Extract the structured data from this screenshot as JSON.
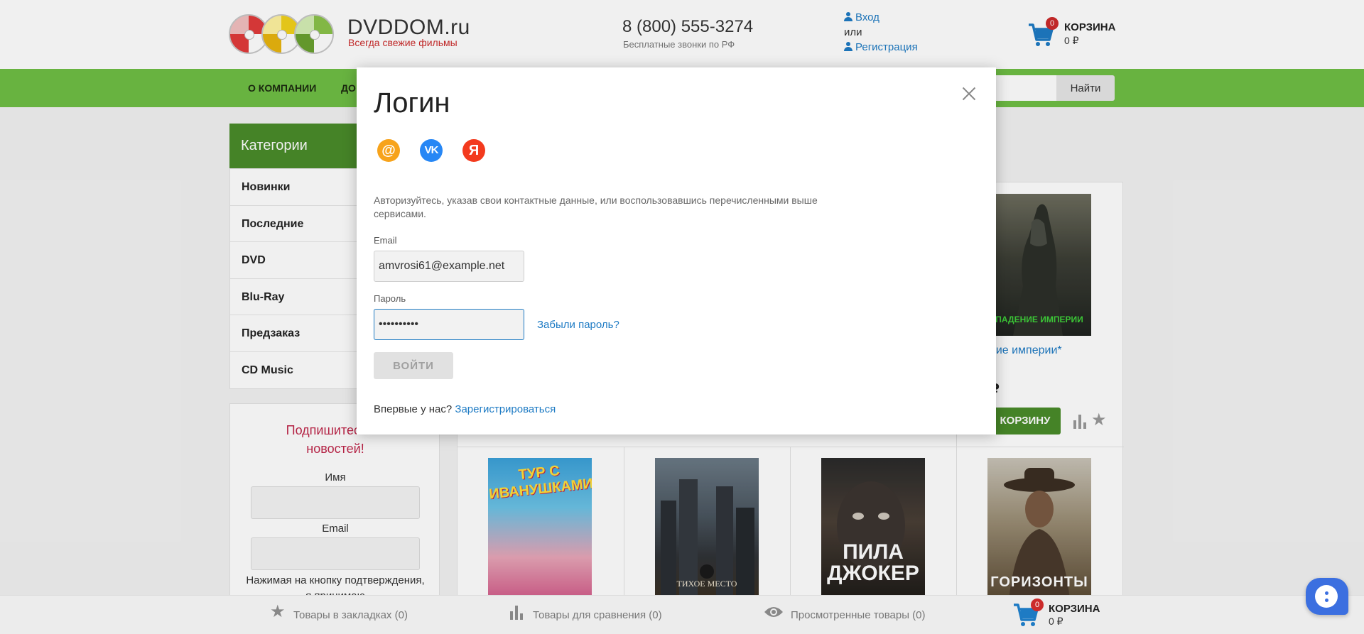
{
  "header": {
    "brand_name": "DVDDOM.ru",
    "brand_tagline": "Всегда свежие фильмы",
    "phone": "8 (800) 555-3274",
    "phone_note": "Бесплатные звонки по РФ",
    "login_link": "Вход",
    "or_text": "или",
    "register_link": "Регистрация",
    "cart_title": "КОРЗИНА",
    "cart_sum": "0 ₽",
    "cart_count": "0"
  },
  "nav": {
    "items": [
      "О КОМПАНИИ",
      "ДО"
    ],
    "search_button": "Найти"
  },
  "sidebar": {
    "categories_title": "Категории",
    "items": [
      "Новинки",
      "Последние",
      "DVD",
      "Blu-Ray",
      "Предзаказ",
      "CD Music"
    ]
  },
  "subscribe": {
    "title_line1": "Подпишитесь на",
    "title_line2": "новостей!",
    "name_label": "Имя",
    "email_label": "Email",
    "note": "Нажимая на кнопку подтверждения, я принимаю"
  },
  "products": {
    "title_fragment": "ние империи*",
    "price_fragment": "₽",
    "cart_button": "КОРЗИНУ",
    "posters": [
      {
        "text": "ПАДЕНИЕ ИМПЕРИИ"
      },
      {
        "text": "ТУР С ИВАНУШКАМИ"
      },
      {
        "text": "ТИХОЕ МЕСТО"
      },
      {
        "text": "ПИЛА ДЖОКЕР"
      },
      {
        "text": "ГОРИЗОНТЫ"
      }
    ]
  },
  "modal": {
    "title": "Логин",
    "social": [
      "@",
      "VK",
      "Я"
    ],
    "description": "Авторизуйтесь, указав свои контактные данные, или воспользовавшись перечисленными выше сервисами.",
    "email_label": "Email",
    "email_value": "amvrosi61@example.net",
    "password_label": "Пароль",
    "password_value": "••••••••••",
    "forgot_link": "Забыли пароль?",
    "login_button": "ВОЙТИ",
    "first_time_text": "Впервые у нас?",
    "register_link": "Зарегистрироваться"
  },
  "bottom_bar": {
    "bookmarks": "Товары в закладках (0)",
    "compare": "Товары для сравнения (0)",
    "viewed": "Просмотренные товары (0)",
    "cart_title": "КОРЗИНА",
    "cart_sum": "0 ₽",
    "cart_count": "0"
  },
  "colors": {
    "accent_green": "#6fbf45",
    "dark_green": "#4a8c2a",
    "link_blue": "#1e7bc4",
    "badge_red": "#cc2b2b"
  }
}
